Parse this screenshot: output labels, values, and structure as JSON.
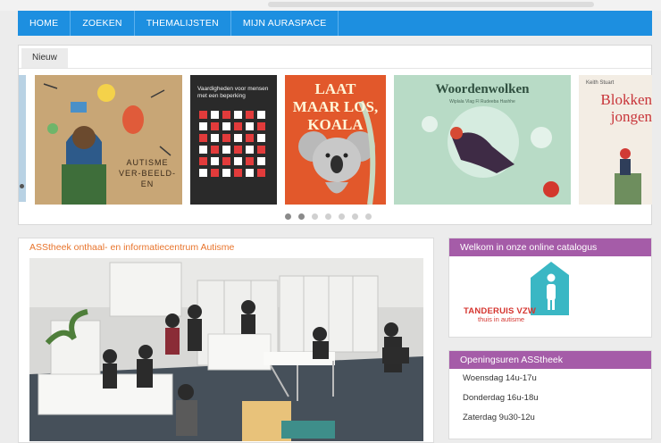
{
  "nav": {
    "items": [
      "HOME",
      "ZOEKEN",
      "THEMALIJSTEN",
      "MIJN AURASPACE"
    ]
  },
  "carousel": {
    "tab_label": "Nieuw",
    "books": [
      {
        "title": "AUTISME VER-BEELD-EN"
      },
      {
        "title": "Vaardigheden voor mensen met een beperking"
      },
      {
        "title": "LAAT MAAR LOS, KOALA"
      },
      {
        "title": "Woordenwolken",
        "subtitle": "Wiplala Vlag Fl Rudeeba Hashhe"
      },
      {
        "title": "Blokken jongen",
        "author": "Keith Stuart"
      }
    ],
    "dot_count": 7,
    "active_dots": [
      0,
      1
    ]
  },
  "main": {
    "title": "ASStheek onthaal- en informatiecentrum Autisme"
  },
  "sidebar": {
    "welcome_title": "Welkom in onze online catalogus",
    "logo_name": "TANDERUIS VZW",
    "logo_tagline": "thuis in autisme",
    "hours_title": "Openingsuren ASStheek",
    "hours": [
      "Woensdag 14u-17u",
      "Donderdag 16u-18u",
      "Zaterdag 9u30-12u"
    ]
  },
  "colors": {
    "nav_blue": "#1d8fe0",
    "panel_purple": "#a55ca8",
    "title_orange": "#e8742c",
    "logo_teal": "#3ab7c4",
    "logo_red": "#d5352f"
  }
}
